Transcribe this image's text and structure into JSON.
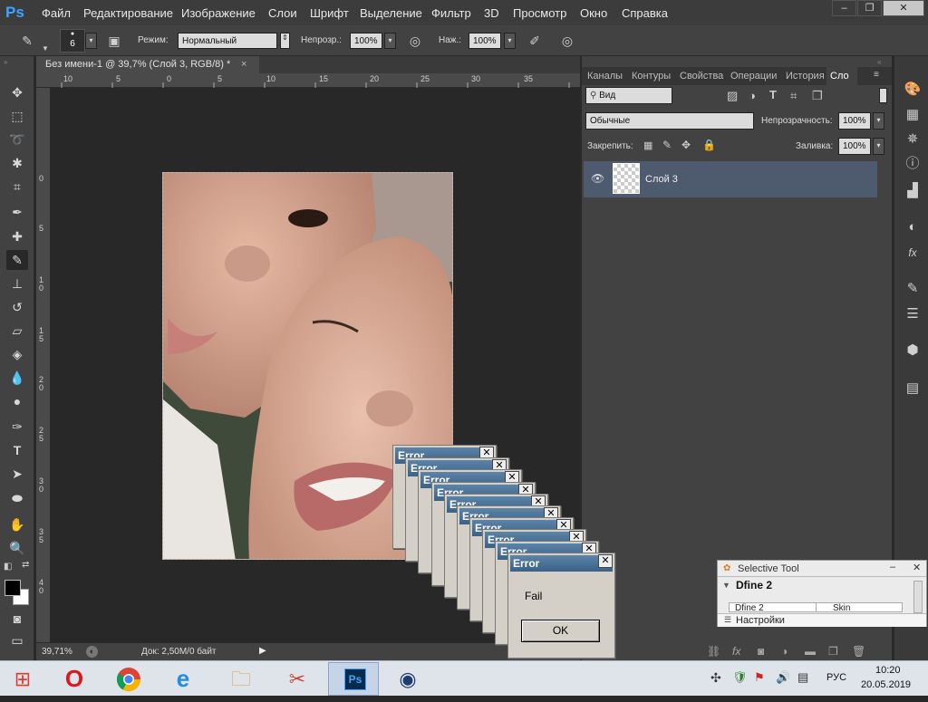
{
  "app": {
    "logo": "Ps"
  },
  "menu": [
    "Файл",
    "Редактирование",
    "Изображение",
    "Слои",
    "Шрифт",
    "Выделение",
    "Фильтр",
    "3D",
    "Просмотр",
    "Окно",
    "Справка"
  ],
  "window_controls": {
    "minimize": "–",
    "restore": "❐",
    "close": "✕"
  },
  "options": {
    "brush_size": "6",
    "mode_label": "Режим:",
    "mode_value": "Нормальный",
    "opacity_label": "Непрозр.:",
    "opacity_value": "100%",
    "pressure_label": "Наж.:",
    "pressure_value": "100%"
  },
  "document": {
    "tab_title": "Без имени-1 @ 39,7% (Слой 3, RGB/8) *",
    "close": "×",
    "zoom": "39,71%",
    "doc_info": "Док: 2,50M/0 байт"
  },
  "ruler_h_ticks": [
    "10",
    "5",
    "0",
    "5",
    "10",
    "15",
    "20",
    "25",
    "30",
    "35"
  ],
  "ruler_v_ticks": [
    "0",
    "5",
    "1 0",
    "1 5",
    "2 0",
    "2 5",
    "3 0",
    "3 5",
    "4 0"
  ],
  "panels": {
    "tabs": [
      "Каналы",
      "Контуры",
      "Свойства",
      "Операции",
      "История",
      "Сло"
    ],
    "filter_kind": "Вид",
    "blend_mode": "Обычные",
    "opacity_label": "Непрозрачность:",
    "opacity_value": "100%",
    "lock_label": "Закрепить:",
    "fill_label": "Заливка:",
    "fill_value": "100%",
    "layer_name": "Слой 3"
  },
  "error_dialog": {
    "title": "Error",
    "message": "Fail",
    "ok": "OK",
    "stack_title": "Error"
  },
  "selective_tool": {
    "title": "Selective Tool",
    "plugin": "Dfine 2",
    "col1": "Dfine 2",
    "col2": "Skin",
    "settings": "Настройки"
  },
  "taskbar": {
    "lang": "РУС",
    "time": "10:20",
    "date": "20.05.2019",
    "apps": [
      "windows-logo",
      "opera",
      "chrome",
      "internet-explorer",
      "file-explorer",
      "screen-capture",
      "photoshop",
      "eye-app"
    ]
  }
}
